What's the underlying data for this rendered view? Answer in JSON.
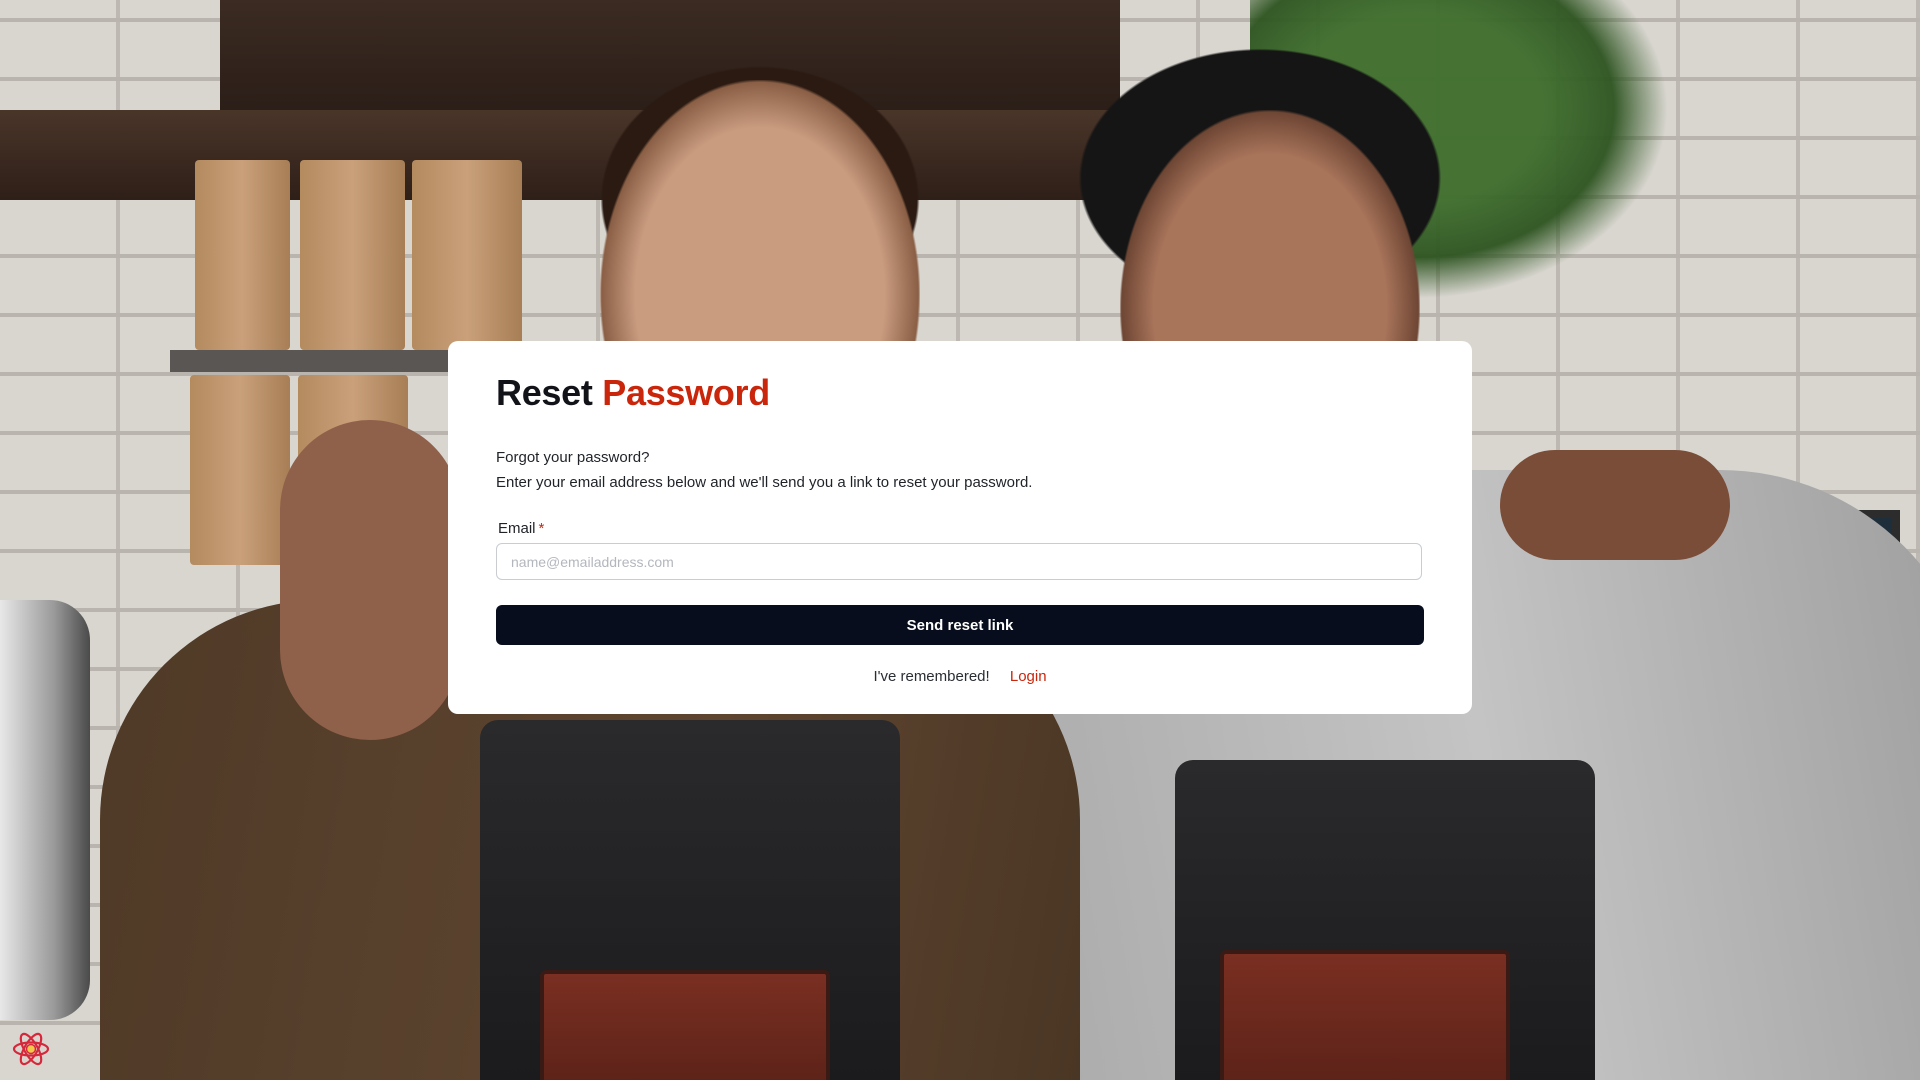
{
  "page": {
    "title_part1": "Reset",
    "title_part2": "Password",
    "intro_line1": "Forgot your password?",
    "intro_line2": "Enter your email address below and we'll send you a link to reset your password."
  },
  "form": {
    "email_label": "Email",
    "email_required_mark": "*",
    "email_value": "",
    "email_placeholder": "name@emailaddress.com",
    "submit_label": "Send reset link"
  },
  "footer": {
    "remembered_text": "I've remembered!",
    "login_label": "Login"
  },
  "theme": {
    "accent": "#c9260b",
    "button_bg": "#070d1c",
    "card_bg": "#ffffff"
  },
  "icons": {
    "corner_badge": "react-atom-icon"
  }
}
